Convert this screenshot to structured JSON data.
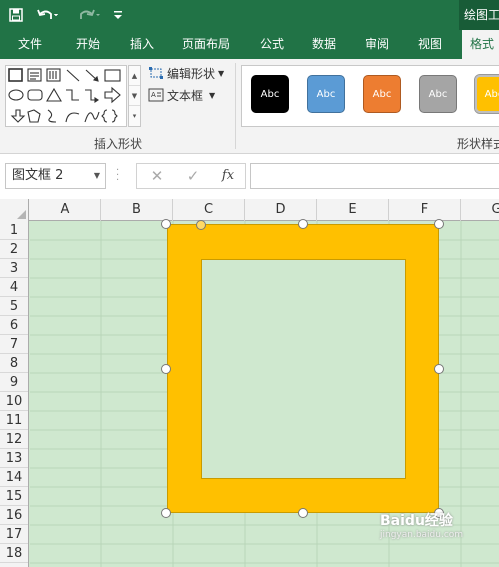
{
  "quick_access": {
    "save_icon": "save-icon",
    "undo_icon": "undo-icon",
    "redo_icon": "redo-icon",
    "customize_icon": "customize-qat-icon"
  },
  "context_title": "绘图工",
  "tabs": [
    "文件",
    "开始",
    "插入",
    "页面布局",
    "公式",
    "数据",
    "审阅",
    "视图",
    "格式"
  ],
  "active_tab": "格式",
  "ribbon": {
    "edit_shape_label": "编辑形状",
    "text_box_label": "文本框",
    "insert_shapes_group": "插入形状",
    "shape_styles_group": "形状样式",
    "style_swatches": [
      {
        "label": "Abc",
        "color": "#000000"
      },
      {
        "label": "Abc",
        "color": "#5b9bd5"
      },
      {
        "label": "Abc",
        "color": "#ed7d31"
      },
      {
        "label": "Abc",
        "color": "#a5a5a5"
      },
      {
        "label": "Abc",
        "color": "#ffc000"
      }
    ]
  },
  "formula_bar": {
    "name_box": "图文框 2",
    "cancel_glyph": "✕",
    "enter_glyph": "✓",
    "fx_label": "fx",
    "formula_value": ""
  },
  "columns": [
    "A",
    "B",
    "C",
    "D",
    "E",
    "F",
    "G"
  ],
  "rows": [
    "1",
    "2",
    "3",
    "4",
    "5",
    "6",
    "7",
    "8",
    "9",
    "10",
    "11",
    "12",
    "13",
    "14",
    "15",
    "16",
    "17",
    "18"
  ],
  "shape": {
    "name": "图文框 2",
    "fill_color": "#ffc000"
  },
  "watermark": {
    "text": "Baidu经验",
    "sub": "jingyan.baidu.com"
  }
}
